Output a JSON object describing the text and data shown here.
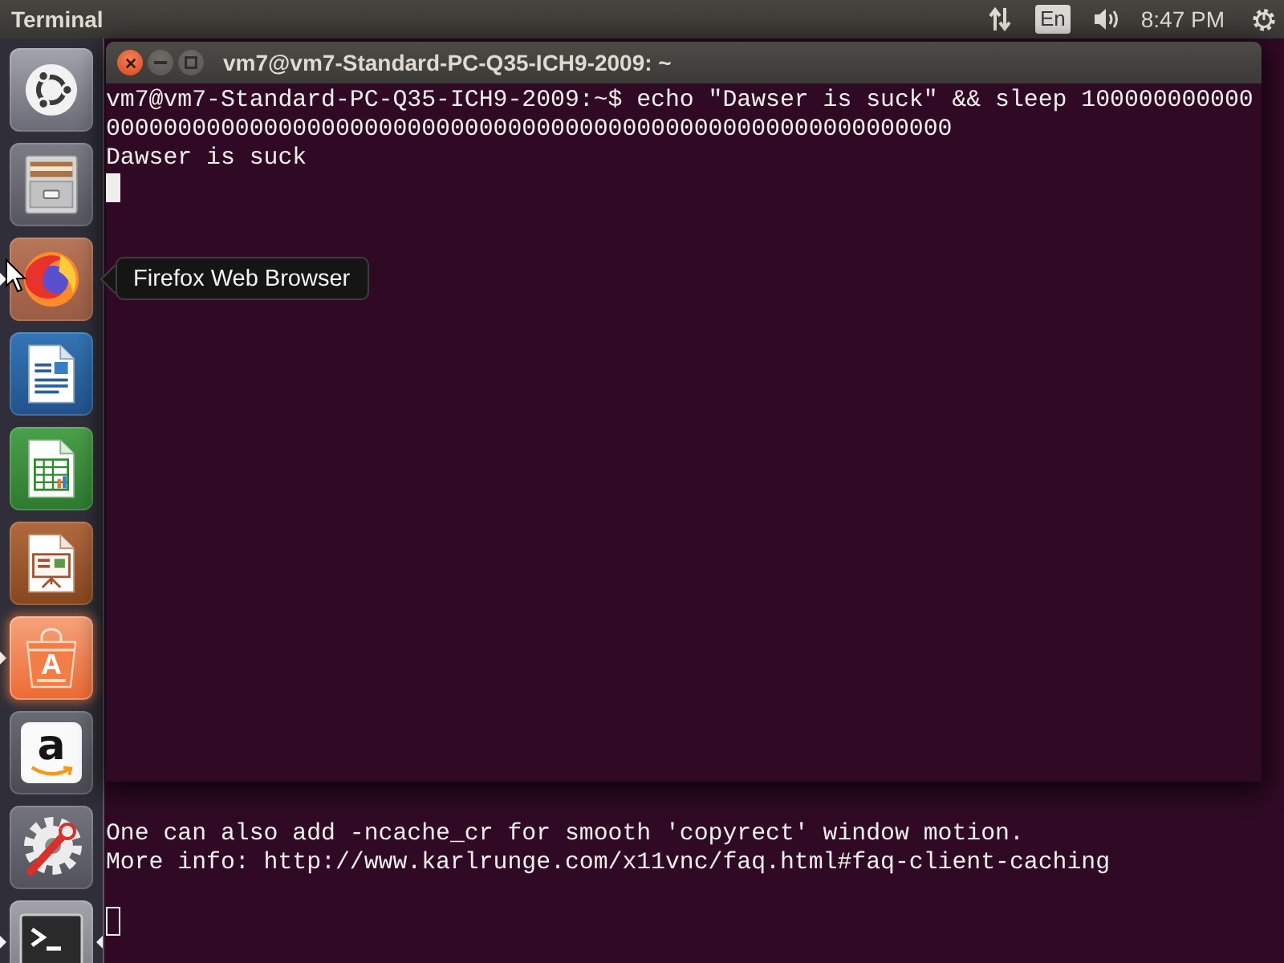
{
  "top_panel": {
    "app_title": "Terminal",
    "keyboard_layout": "En",
    "clock": "8:47 PM"
  },
  "launcher": {
    "items": [
      {
        "kind": "dash",
        "running": false,
        "focused": false
      },
      {
        "kind": "files",
        "running": false,
        "focused": false
      },
      {
        "kind": "firefox",
        "running": true,
        "focused": false
      },
      {
        "kind": "writer",
        "running": false,
        "focused": false
      },
      {
        "kind": "calc",
        "running": false,
        "focused": false
      },
      {
        "kind": "impress",
        "running": false,
        "focused": false
      },
      {
        "kind": "software",
        "glyph": "A",
        "running": true,
        "focused": false
      },
      {
        "kind": "amazon",
        "glyph": "a",
        "running": false,
        "focused": false
      },
      {
        "kind": "settings",
        "running": false,
        "focused": false
      },
      {
        "kind": "terminal",
        "running": true,
        "focused": true
      }
    ],
    "tooltip": {
      "text": "Firefox Web Browser"
    }
  },
  "background_terminal": {
    "focused": false,
    "lines": [
      "One can also add -ncache_cr for smooth 'copyrect' window motion.",
      "More info: http://www.karlrunge.com/x11vnc/faq.html#faq-client-caching"
    ]
  },
  "terminal_window": {
    "title": "vm7@vm7-Standard-PC-Q35-ICH9-2009: ~",
    "focused": true,
    "lines": [
      "vm7@vm7-Standard-PC-Q35-ICH9-2009:~$ echo \"Dawser is suck\" && sleep 100000000000",
      "00000000000000000000000000000000000000000000000000000000000",
      "Dawser is suck"
    ]
  }
}
